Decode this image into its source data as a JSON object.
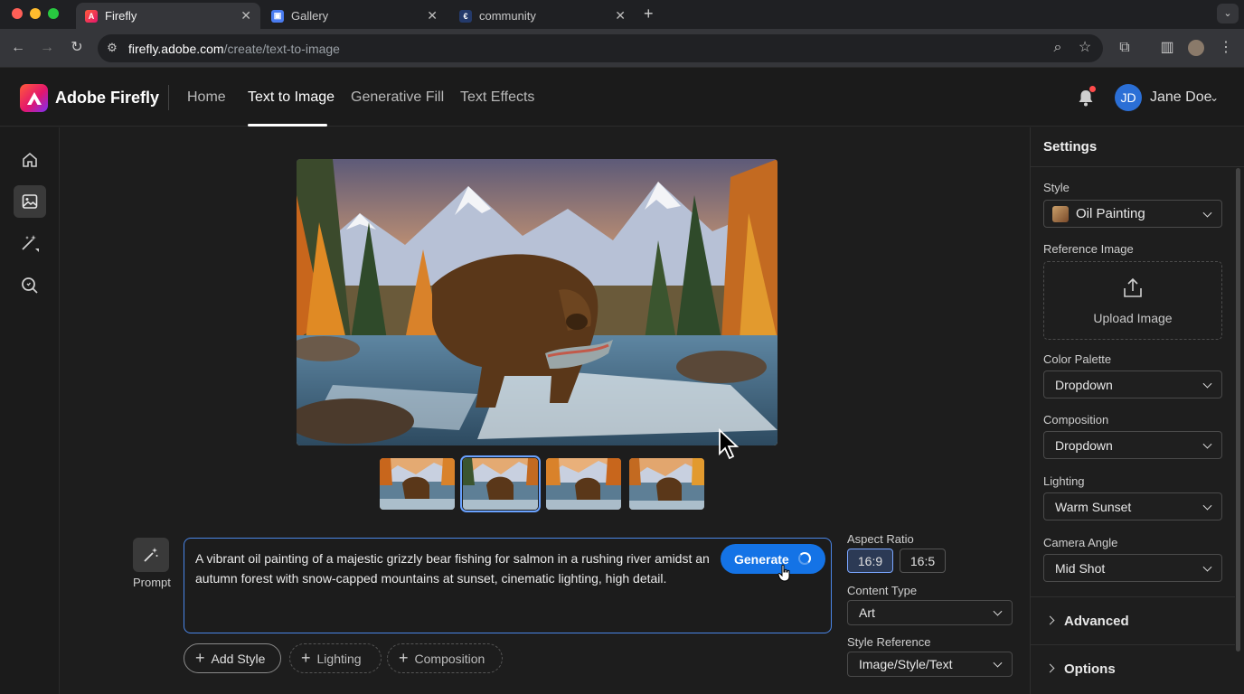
{
  "browser": {
    "tabs": [
      {
        "title": "Firefly",
        "active": true
      },
      {
        "title": "Gallery",
        "active": false
      },
      {
        "title": "community",
        "active": false
      }
    ],
    "url_domain": "firefly.adobe.com",
    "url_path": "/create/text-to-image",
    "new_tab": "+"
  },
  "app": {
    "brand": "Adobe Firefly",
    "nav": [
      "Home",
      "Text to Image",
      "Generative Fill",
      "Text Effects"
    ],
    "active_nav": "Text to Image",
    "user": {
      "initials": "JD",
      "name": "Jane Doe"
    },
    "notification_dot_color": "#ff4b4b"
  },
  "rail": {
    "icons": [
      "home-icon",
      "image-icon",
      "magic-wand-icon",
      "search-icon"
    ],
    "selected": "image-icon"
  },
  "gallery": {
    "thumbnail_count": 4,
    "selected_thumbnail": 2
  },
  "prompt": {
    "label": "Prompt",
    "text": "A vibrant oil painting of a majestic grizzly bear fishing for salmon in a rushing river amidst an autumn forest with snow-capped mountains at sunset, cinematic lighting, high detail.",
    "generate_label": "Generate",
    "chips": [
      "Add Style",
      "Lighting",
      "Composition"
    ]
  },
  "options": {
    "aspect_ratio_label": "Aspect Ratio",
    "aspect_ratios": [
      "16:9",
      "16:5"
    ],
    "aspect_selected": "16:9",
    "content_type_label": "Content Type",
    "content_type_value": "Art",
    "style_reference_label": "Style Reference",
    "style_reference_value": "Image/Style/Text"
  },
  "settings": {
    "title": "Settings",
    "style_label": "Style",
    "style_value": "Oil Painting",
    "reference_label": "Reference Image",
    "upload_label": "Upload Image",
    "color_palette_label": "Color Palette",
    "color_palette_value": "Dropdown",
    "composition_label": "Composition",
    "composition_value": "Dropdown",
    "lighting_label": "Lighting",
    "lighting_value": "Warm Sunset",
    "camera_label": "Camera Angle",
    "camera_value": "Mid Shot",
    "sections": [
      "Advanced",
      "Options"
    ]
  },
  "colors": {
    "accent": "#1473e6",
    "selection_outline": "#6aa2ff"
  }
}
